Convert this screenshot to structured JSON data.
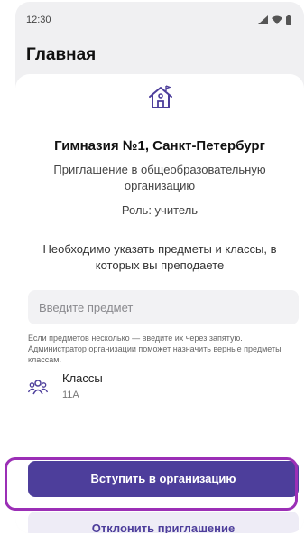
{
  "status_bar": {
    "time": "12:30"
  },
  "header": {
    "title": "Главная"
  },
  "invitation": {
    "icon": "house-icon",
    "org_name": "Гимназия №1, Санкт-Петербург",
    "invite_text": "Приглашение в общеобразовательную организацию",
    "role": "Роль: учитель",
    "requirement": "Необходимо указать предметы и классы, в которых вы преподаете"
  },
  "subject_input": {
    "placeholder": "Введите предмет",
    "value": ""
  },
  "hint": "Если предметов несколько — введите их через запятую. Администратор организации поможет назначить верные предметы классам.",
  "classes": {
    "icon": "group-icon",
    "label": "Классы",
    "value": "11А"
  },
  "actions": {
    "join_label": "Вступить в организацию",
    "decline_label": "Отклонить приглашение"
  },
  "colors": {
    "accent": "#4d3e9b",
    "highlight": "#9b2fb6",
    "secondary_button_bg": "#eeecf6"
  }
}
